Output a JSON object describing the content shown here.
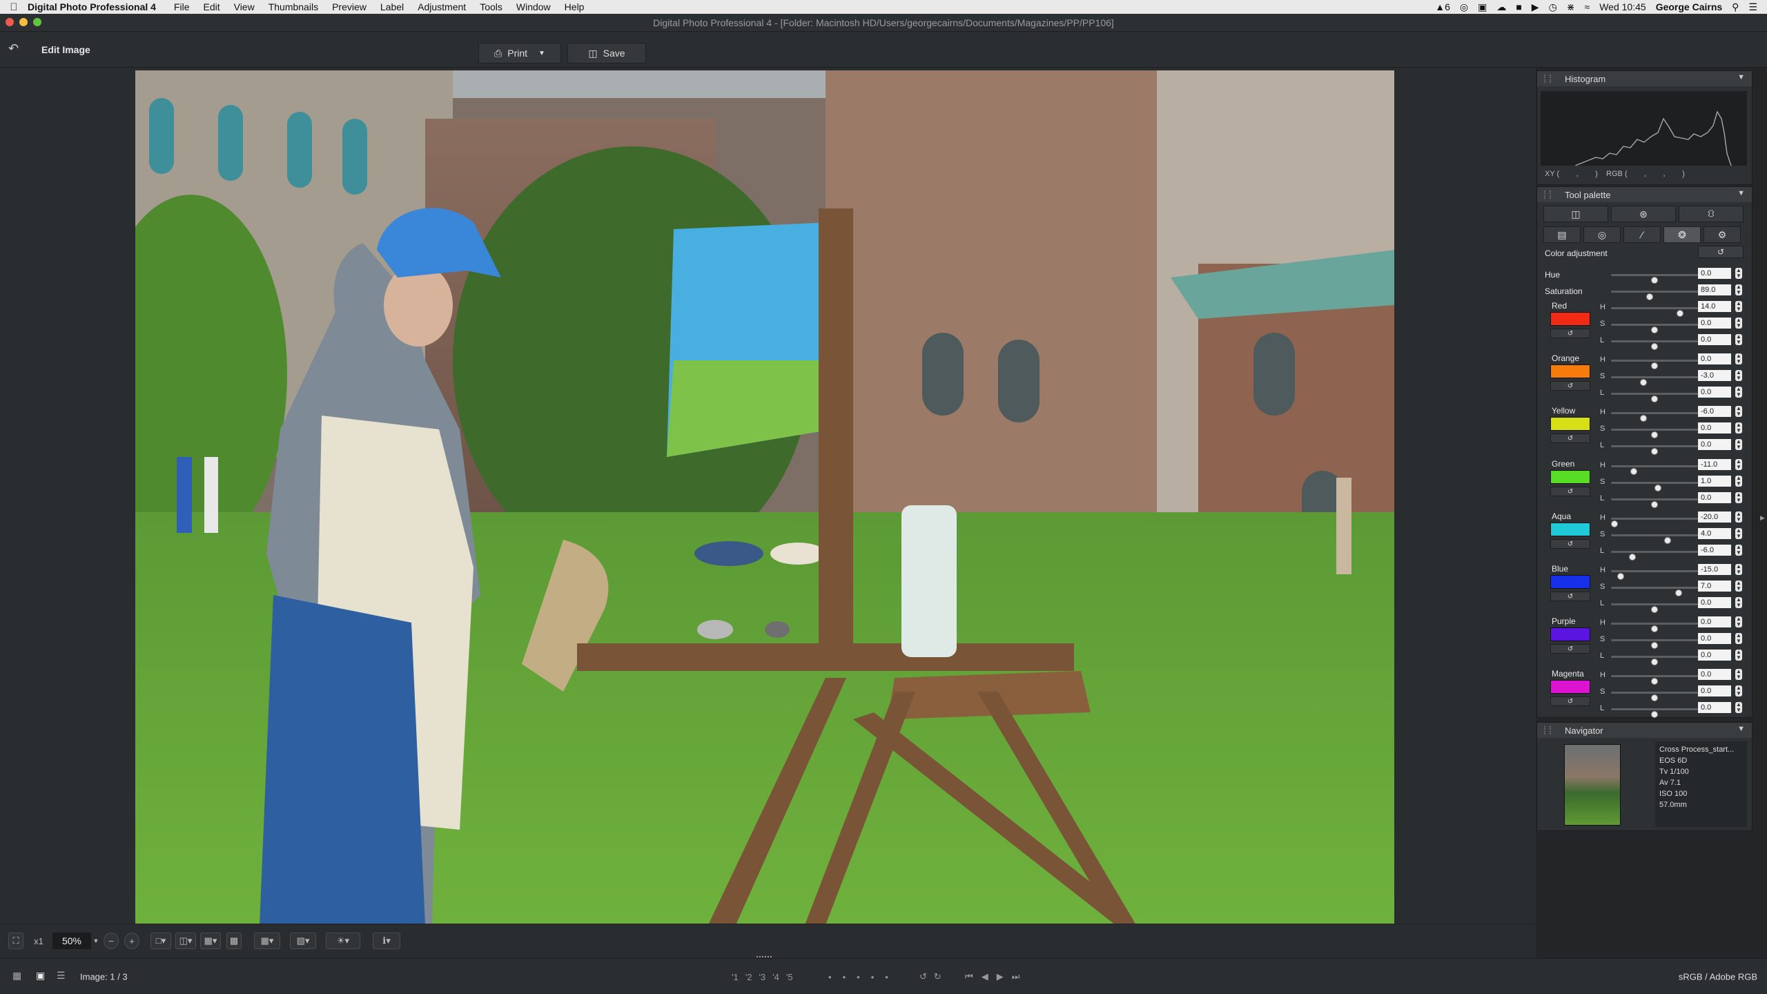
{
  "menubar": {
    "app_name": "Digital Photo Professional 4",
    "items": [
      "File",
      "Edit",
      "View",
      "Thumbnails",
      "Preview",
      "Label",
      "Adjustment",
      "Tools",
      "Window",
      "Help"
    ],
    "status_badge": "6",
    "clock": "Wed 10:45",
    "user": "George Cairns"
  },
  "window": {
    "title": "Digital Photo Professional 4 - [Folder: Macintosh HD/Users/georgecairns/Documents/Magazines/PP/PP106]"
  },
  "toolbar": {
    "title": "Edit Image",
    "print_label": "Print",
    "save_label": "Save"
  },
  "statusbar": {
    "zoom_x1": "x1",
    "zoom_value": "50%",
    "image_count": "Image: 1 / 3",
    "color_space": "sRGB / Adobe RGB",
    "rating_marks": [
      "'1",
      "'2",
      "'3",
      "'4",
      "'5"
    ]
  },
  "histogram": {
    "title": "Histogram",
    "xy_label": "XY (        ,        )",
    "rgb_label": "RGB (        ,        ,        )"
  },
  "tool_palette": {
    "title": "Tool palette",
    "section_title": "Color adjustment",
    "hue": {
      "label": "Hue",
      "value": "0.0",
      "level": 0.5
    },
    "saturation": {
      "label": "Saturation",
      "value": "89.0",
      "level": 0.44
    },
    "colors": [
      {
        "name": "Red",
        "swatch": "#f02a14",
        "rows": [
          {
            "ch": "H",
            "value": "14.0",
            "level": 0.82
          },
          {
            "ch": "S",
            "value": "0.0",
            "level": 0.5
          },
          {
            "ch": "L",
            "value": "0.0",
            "level": 0.5
          }
        ]
      },
      {
        "name": "Orange",
        "swatch": "#f57c0a",
        "rows": [
          {
            "ch": "H",
            "value": "0.0",
            "level": 0.5
          },
          {
            "ch": "S",
            "value": "-3.0",
            "level": 0.36
          },
          {
            "ch": "L",
            "value": "0.0",
            "level": 0.5
          }
        ]
      },
      {
        "name": "Yellow",
        "swatch": "#d6e015",
        "rows": [
          {
            "ch": "H",
            "value": "-6.0",
            "level": 0.36
          },
          {
            "ch": "S",
            "value": "0.0",
            "level": 0.5
          },
          {
            "ch": "L",
            "value": "0.0",
            "level": 0.5
          }
        ]
      },
      {
        "name": "Green",
        "swatch": "#58dc26",
        "rows": [
          {
            "ch": "H",
            "value": "-11.0",
            "level": 0.24
          },
          {
            "ch": "S",
            "value": "1.0",
            "level": 0.54
          },
          {
            "ch": "L",
            "value": "0.0",
            "level": 0.5
          }
        ]
      },
      {
        "name": "Aqua",
        "swatch": "#1fc9d8",
        "rows": [
          {
            "ch": "H",
            "value": "-20.0",
            "level": 0.0
          },
          {
            "ch": "S",
            "value": "4.0",
            "level": 0.66
          },
          {
            "ch": "L",
            "value": "-6.0",
            "level": 0.22
          }
        ]
      },
      {
        "name": "Blue",
        "swatch": "#1530e8",
        "rows": [
          {
            "ch": "H",
            "value": "-15.0",
            "level": 0.08
          },
          {
            "ch": "S",
            "value": "7.0",
            "level": 0.8
          },
          {
            "ch": "L",
            "value": "0.0",
            "level": 0.5
          }
        ]
      },
      {
        "name": "Purple",
        "swatch": "#5a15e0",
        "rows": [
          {
            "ch": "H",
            "value": "0.0",
            "level": 0.5
          },
          {
            "ch": "S",
            "value": "0.0",
            "level": 0.5
          },
          {
            "ch": "L",
            "value": "0.0",
            "level": 0.5
          }
        ]
      },
      {
        "name": "Magenta",
        "swatch": "#dc14d2",
        "rows": [
          {
            "ch": "H",
            "value": "0.0",
            "level": 0.5
          },
          {
            "ch": "S",
            "value": "0.0",
            "level": 0.5
          },
          {
            "ch": "L",
            "value": "0.0",
            "level": 0.5
          }
        ]
      }
    ]
  },
  "navigator": {
    "title": "Navigator",
    "info": [
      "Cross Process_start...",
      "EOS 6D",
      "Tv 1/100",
      "Av 7.1",
      "ISO 100",
      "57.0mm"
    ]
  }
}
